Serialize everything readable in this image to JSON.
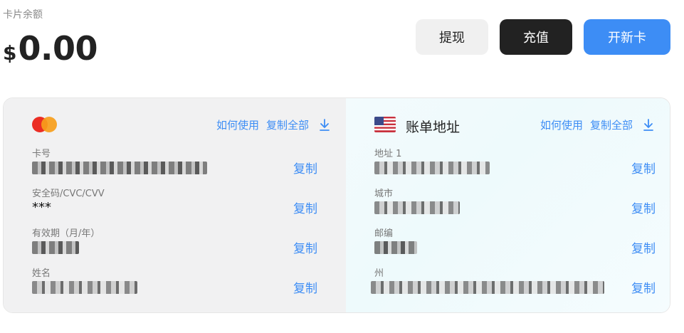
{
  "balance": {
    "label": "卡片余额",
    "currency": "$",
    "amount": "0.00"
  },
  "actions": {
    "withdraw": "提现",
    "recharge": "充值",
    "new_card": "开新卡"
  },
  "card": {
    "header": {
      "how_to_use": "如何使用",
      "copy_all": "复制全部"
    },
    "fields": [
      {
        "label": "卡号",
        "copy": "复制"
      },
      {
        "label": "安全码/CVC/CVV",
        "value": "***",
        "copy": "复制"
      },
      {
        "label": "有效期（月/年）",
        "copy": "复制"
      },
      {
        "label": "姓名",
        "copy": "复制"
      }
    ]
  },
  "billing": {
    "title": "账单地址",
    "header": {
      "how_to_use": "如何使用",
      "copy_all": "复制全部"
    },
    "fields": [
      {
        "label": "地址 1",
        "copy": "复制"
      },
      {
        "label": "城市",
        "copy": "复制"
      },
      {
        "label": "邮编",
        "copy": "复制"
      },
      {
        "label": "州",
        "copy": "复制"
      }
    ]
  },
  "colors": {
    "accent": "#3d8df5",
    "dark_button": "#222222",
    "light_button": "#f0f0f0"
  }
}
